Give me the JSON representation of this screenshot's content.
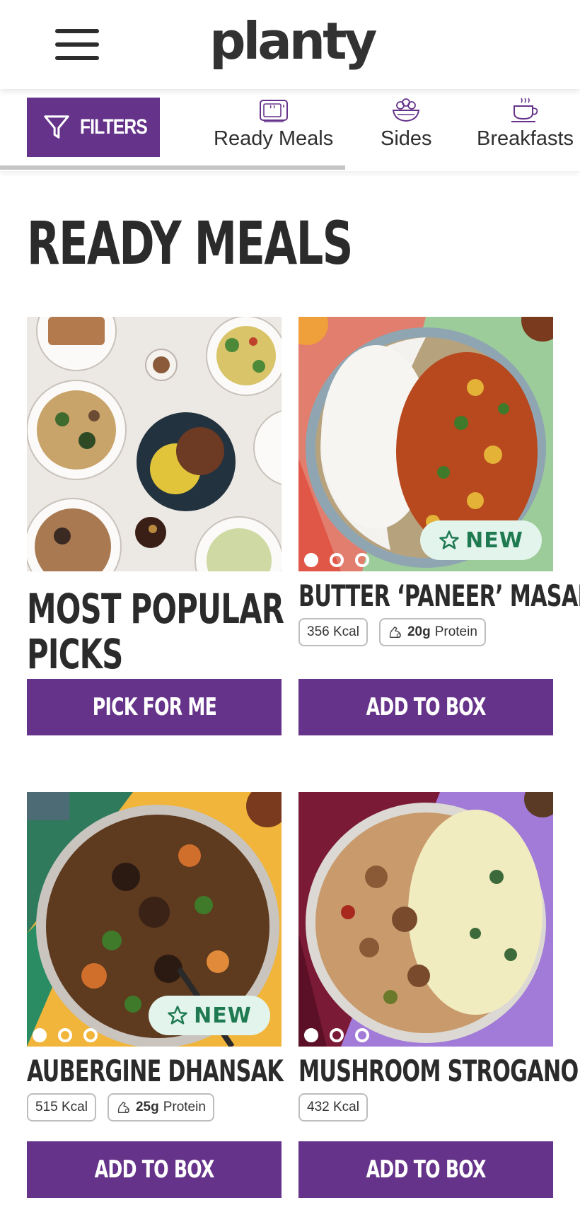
{
  "header": {
    "logo_text": "planty",
    "menu_icon": "hamburger-menu-icon"
  },
  "category_bar": {
    "filters_label": "FILTERS",
    "filters_icon": "funnel-icon",
    "categories": [
      {
        "label": "Ready Meals",
        "icon": "ready-meal-tray-icon"
      },
      {
        "label": "Sides",
        "icon": "salad-bowl-icon"
      },
      {
        "label": "Breakfasts",
        "icon": "steaming-cup-icon"
      }
    ]
  },
  "main": {
    "page_title": "READY MEALS",
    "cards": [
      {
        "title_line1": "MOST POPULAR",
        "title_line2": "PICKS",
        "button_label": "PICK FOR ME"
      },
      {
        "title": "BUTTER ‘PANEER’ MASALA",
        "badge": "NEW",
        "kcal": "356 Kcal",
        "protein_value": "20g",
        "protein_label": "Protein",
        "button_label": "ADD TO BOX",
        "carousel_images": 3,
        "active_image": 1
      },
      {
        "title": "AUBERGINE DHANSAK",
        "badge": "NEW",
        "kcal": "515 Kcal",
        "protein_value": "25g",
        "protein_label": "Protein",
        "button_label": "ADD TO BOX",
        "carousel_images": 3,
        "active_image": 1
      },
      {
        "title": "MUSHROOM STROGANOFF",
        "kcal": "432 Kcal",
        "button_label": "ADD TO BOX",
        "carousel_images": 3,
        "active_image": 1
      }
    ]
  },
  "colors": {
    "brand_purple": "#65348a",
    "badge_bg": "#e3f4ec",
    "badge_text": "#1f7a52",
    "text_dark": "#2b2b2b"
  }
}
